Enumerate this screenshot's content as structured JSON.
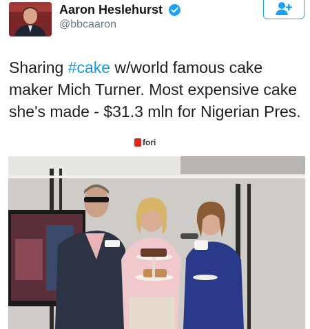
{
  "author": {
    "name": "Aaron Heslehurst",
    "handle": "@bbcaaron",
    "verified_icon": "verified-badge-icon",
    "avatar_icon": "profile-avatar"
  },
  "follow_button": {
    "icon": "add-user-icon",
    "color": "#1da1f2"
  },
  "tweet": {
    "text_before": "Sharing ",
    "hashtag": "#cake",
    "text_after": " w/world famous cake maker Mich Turner. Most expensive cake she's made - $31.3 mln for Nigerian Pres."
  },
  "watermark": {
    "text": "fori"
  },
  "colors": {
    "link": "#1b95e0",
    "accent": "#1da1f2",
    "text": "#14171a",
    "muted": "#657786"
  }
}
